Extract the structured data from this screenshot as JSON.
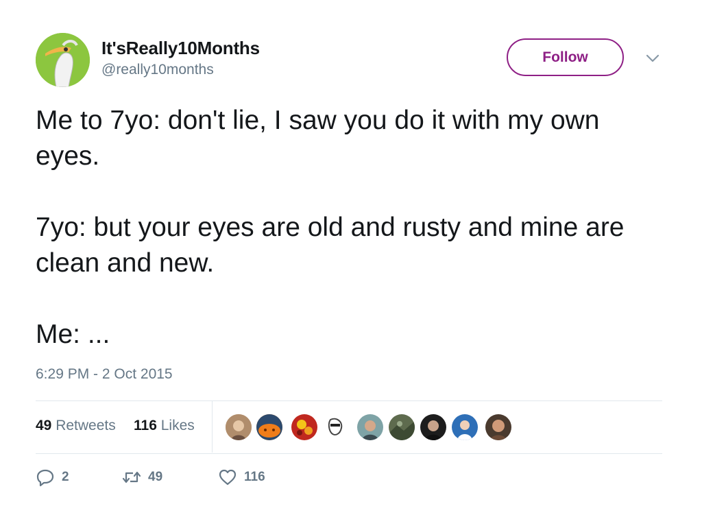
{
  "user": {
    "display_name": "It'sReally10Months",
    "handle": "@really10months",
    "avatar_icon": "pelican-avatar"
  },
  "follow_label": "Follow",
  "body": {
    "paragraphs": [
      "Me to 7yo: don't lie, I saw you do it with my own eyes.",
      "7yo: but your eyes are old and rusty and mine are clean and new.",
      "Me: ..."
    ]
  },
  "timestamp": "6:29 PM - 2 Oct 2015",
  "stats": {
    "retweets_count": "49",
    "retweets_label": "Retweets",
    "likes_count": "116",
    "likes_label": "Likes"
  },
  "likers": [
    "liker-avatar-1",
    "liker-avatar-2",
    "liker-avatar-3",
    "liker-avatar-4",
    "liker-avatar-5",
    "liker-avatar-6",
    "liker-avatar-7",
    "liker-avatar-8",
    "liker-avatar-9"
  ],
  "actions": {
    "reply_count": "2",
    "retweet_count": "49",
    "like_count": "116"
  },
  "colors": {
    "accent": "#8e1f85",
    "secondary_text": "#657786",
    "primary_text": "#14171a",
    "divider": "#e1e8ed"
  }
}
